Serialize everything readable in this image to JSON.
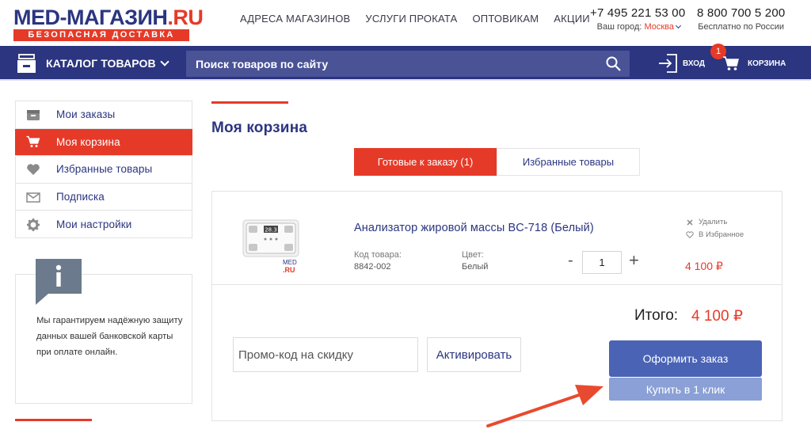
{
  "header": {
    "logo_main": "MED-МАГАЗИН",
    "logo_tld": ".RU",
    "logo_sub": "БЕЗОПАСНАЯ ДОСТАВКА",
    "nav": [
      "АДРЕСА МАГАЗИНОВ",
      "УСЛУГИ ПРОКАТА",
      "ОПТОВИКАМ",
      "АКЦИИ"
    ],
    "phone_msk": "+7 495 221 53 00",
    "city_label": "Ваш город:",
    "city": "Москва",
    "phone_free": "8 800 700 5 200",
    "phone_free_sub": "Бесплатно по России"
  },
  "navbar": {
    "catalog_label": "КАТАЛОГ ТОВАРОВ",
    "search_placeholder": "Поиск товаров по сайту",
    "login_label": "ВХОД",
    "cart_label": "КОРЗИНА",
    "cart_count": "1"
  },
  "sidebar": {
    "items": [
      {
        "label": "Мои заказы",
        "icon": "orders-box-icon"
      },
      {
        "label": "Моя корзина",
        "icon": "cart-icon"
      },
      {
        "label": "Избранные товары",
        "icon": "heart-icon"
      },
      {
        "label": "Подписка",
        "icon": "envelope-icon"
      },
      {
        "label": "Мои настройки",
        "icon": "gear-icon"
      }
    ],
    "info_text": "Мы гарантируем надёжную защиту данных вашей банковской карты при оплате онлайн."
  },
  "main": {
    "title": "Моя корзина",
    "tabs": [
      {
        "label": "Готовые к заказу (1)",
        "active": true
      },
      {
        "label": "Избранные товары",
        "active": false
      }
    ],
    "item": {
      "name": "Анализатор жировой массы BC-718 (Белый)",
      "code_label": "Код товара:",
      "code_value": "8842-002",
      "color_label": "Цвет:",
      "color_value": "Белый",
      "qty_minus": "-",
      "qty": "1",
      "qty_plus": "+",
      "price": "4 100 ₽",
      "remove_label": "Удалить",
      "favorite_label": "В Избранное",
      "watermark_top": "MED",
      "watermark_bottom": ".RU"
    },
    "total_label": "Итого:",
    "total_value": "4 100 ₽",
    "promo_placeholder": "Промо-код на скидку",
    "activate_label": "Активировать",
    "order_label": "Оформить заказ",
    "oneclick_label": "Купить в 1 клик"
  },
  "colors": {
    "brand_blue": "#2b3580",
    "brand_red": "#e63a28",
    "button_blue": "#4a63b5",
    "button_light": "#8aa0d6"
  }
}
